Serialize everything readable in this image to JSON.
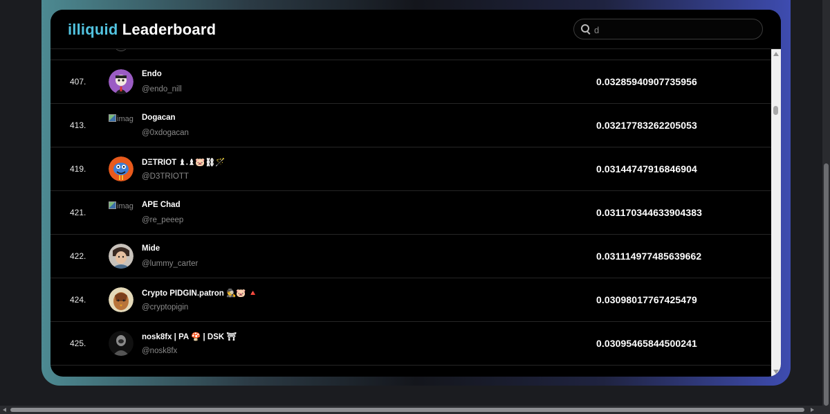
{
  "header": {
    "brand": "illiquid",
    "title": "Leaderboard"
  },
  "search": {
    "value": "d",
    "placeholder": ""
  },
  "rows": [
    {
      "rank": "407.",
      "name": "Endo",
      "handle": "@endo_nill",
      "score": "0.03285940907735956",
      "avatar": "avatar-image"
    },
    {
      "rank": "413.",
      "name": "Dogacan",
      "handle": "@0xdogacan",
      "score": "0.03217783262205053",
      "avatar": "broken-image",
      "alt": "imag"
    },
    {
      "rank": "419.",
      "name": "DΞTRIOT ♝.♝🐷⛓🪄",
      "handle": "@D3TRIOTT",
      "score": "0.03144747916846904",
      "avatar": "avatar-image"
    },
    {
      "rank": "421.",
      "name": "APE Chad",
      "handle": "@re_peeep",
      "score": "0.031170344633904383",
      "avatar": "broken-image",
      "alt": "imag"
    },
    {
      "rank": "422.",
      "name": "Mide",
      "handle": "@lummy_carter",
      "score": "0.031114977485639662",
      "avatar": "avatar-image"
    },
    {
      "rank": "424.",
      "name": "Crypto PIDGIN.patron 🕵🐷 🔺",
      "handle": "@cryptopigin",
      "score": "0.03098017767425479",
      "avatar": "avatar-image"
    },
    {
      "rank": "425.",
      "name": "nosk8fx | PA 🍄 | DSK ⛩",
      "handle": "@nosk8fx",
      "score": "0.03095465844500241",
      "avatar": "avatar-image"
    }
  ],
  "colors": {
    "brand": "#52c3e0",
    "avatar_endo": "#9b5cc4",
    "avatar_detriot": "#e85a1c",
    "avatar_mide": "#8a7a6a",
    "avatar_pidgin": "#c98a3a",
    "avatar_nosk": "#3a3a3a"
  }
}
